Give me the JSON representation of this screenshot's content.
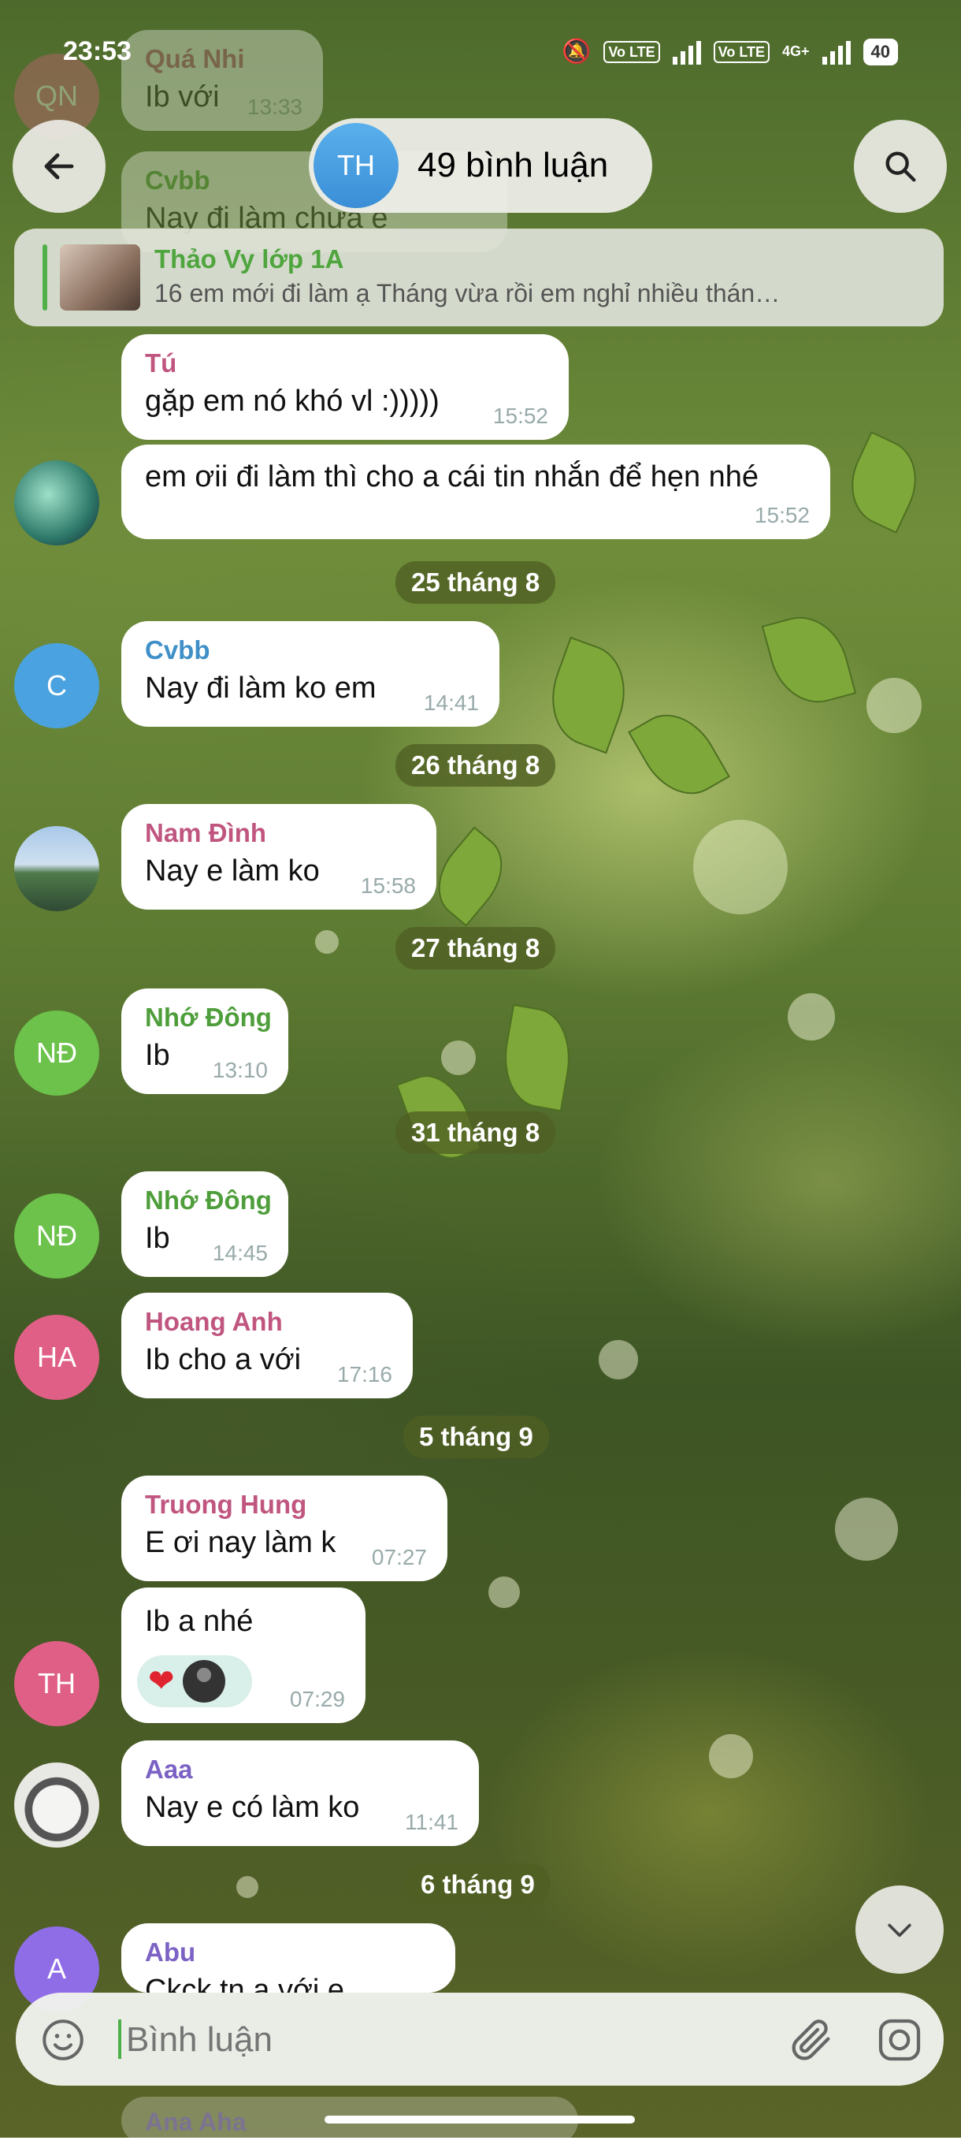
{
  "status_bar": {
    "time": "23:53",
    "battery": "40",
    "network": "4G+",
    "volte1": "Vo LTE",
    "volte2": "Vo LTE"
  },
  "header": {
    "title": "49 bình luận",
    "avatar_initials": "TH",
    "avatar_color": "#4a9fe0"
  },
  "pinned": {
    "author": "Thảo Vy lớp 1A",
    "preview": "16 em mới đi làm ạ  Tháng vừa rồi em nghỉ nhiều  thán…"
  },
  "faded_top": [
    {
      "initials": "QN",
      "name": "Quá Nhi",
      "text": "Ib với",
      "time": "13:33"
    },
    {
      "name": "Cvbb",
      "text": "Nay đi làm chưa e"
    }
  ],
  "messages": [
    {
      "name": "Tú",
      "name_color": "#c0567f",
      "text": "gặp em nó khó vl :)))))",
      "time": "15:52"
    },
    {
      "text": "em ơii đi làm thì cho a cái tin nhắn để hẹn nhé",
      "time": "15:52"
    },
    {
      "date": "25 tháng 8"
    },
    {
      "initials": "C",
      "name": "Cvbb",
      "name_color": "#3f8fc8",
      "text": "Nay đi làm ko em",
      "time": "14:41"
    },
    {
      "date": "26 tháng 8"
    },
    {
      "name": "Nam Đình",
      "name_color": "#c0567f",
      "text": "Nay e làm ko",
      "time": "15:58"
    },
    {
      "date": "27 tháng 8"
    },
    {
      "initials": "NĐ",
      "name": "Nhớ Đông",
      "name_color": "#4f9e3c",
      "text": "Ib",
      "time": "13:10"
    },
    {
      "date": "31 tháng 8"
    },
    {
      "initials": "NĐ",
      "name": "Nhớ Đông",
      "name_color": "#4f9e3c",
      "text": "Ib",
      "time": "14:45"
    },
    {
      "initials": "HA",
      "name": "Hoang Anh",
      "name_color": "#c0567f",
      "text": "Ib cho a với",
      "time": "17:16"
    },
    {
      "date": "5 tháng 9"
    },
    {
      "name": "Truong Hung",
      "name_color": "#c0567f",
      "text": "E ơi nay làm k",
      "time": "07:27"
    },
    {
      "initials": "TH",
      "text": "Ib a nhé",
      "time": "07:29",
      "reactions": [
        "heart",
        "avatar"
      ]
    },
    {
      "name": "Aaa",
      "name_color": "#7b62c4",
      "text": "Nay e có làm ko",
      "time": "11:41"
    },
    {
      "date": "6 tháng 9"
    },
    {
      "initials": "A",
      "name": "Abu",
      "name_color": "#7b62c4",
      "text": "Ckck tn a với e"
    }
  ],
  "bottom_peek": {
    "name": "Ana Aha"
  },
  "input": {
    "placeholder": "Bình luận"
  },
  "colors": {
    "green_avatar": "#6cc24a",
    "pink_avatar": "#e05f86",
    "blue_avatar": "#4aa3e0",
    "purple_avatar": "#8f6de6"
  },
  "icons": [
    "back-arrow-icon",
    "search-icon",
    "emoji-icon",
    "attach-icon",
    "camera-icon",
    "scroll-down-icon"
  ]
}
